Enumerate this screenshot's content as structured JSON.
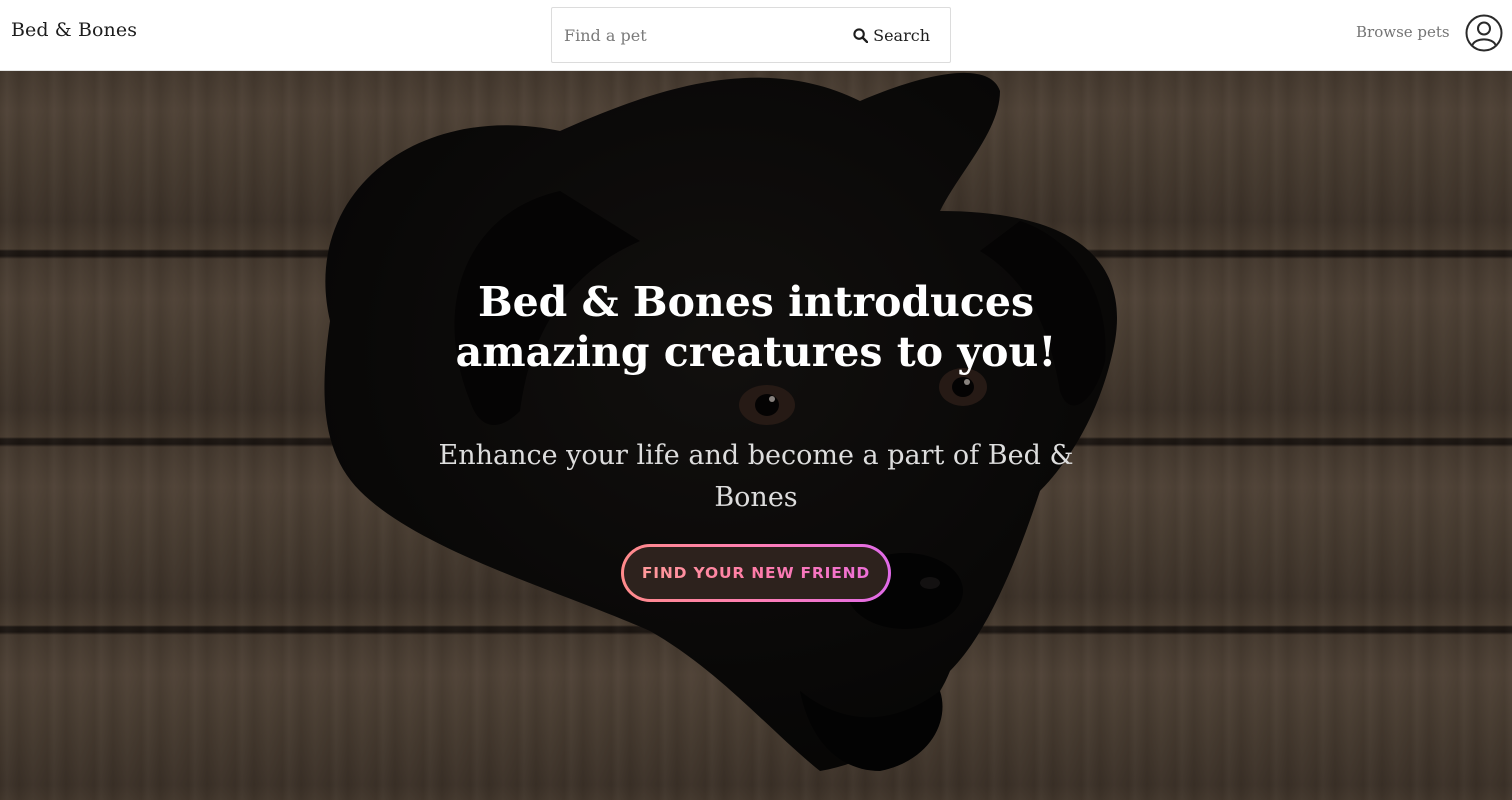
{
  "header": {
    "brand": "Bed & Bones",
    "search": {
      "placeholder": "Find a pet",
      "value": "",
      "button_label": "Search"
    },
    "browse_label": "Browse pets",
    "icons": {
      "search": "search-icon",
      "account": "user-circle-icon"
    }
  },
  "hero": {
    "title": "Bed & Bones introduces amazing creatures to you!",
    "subtitle": "Enhance your life and become a part of Bed & Bones",
    "cta_label": "FIND YOUR NEW FRIEND",
    "cta_gradient": [
      "#ff8a8a",
      "#ff7fb4",
      "#e06ae8"
    ]
  },
  "colors": {
    "header_bg": "#ffffff",
    "text": "#1d1d1d",
    "muted": "#757575",
    "accent": "#ff7fb4"
  }
}
